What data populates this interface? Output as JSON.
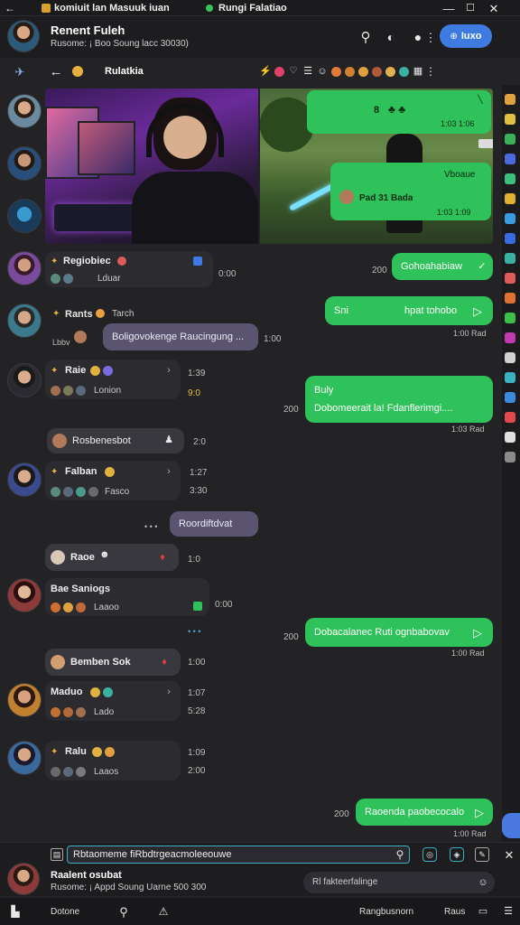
{
  "titlebar": {
    "title": "komiuit lan Masuuk iuan",
    "subtitle": "Rungi Falatiao"
  },
  "header": {
    "name": "Renent Fuleh",
    "status": "Rusome: ¡ Boo Soung lacc 30030)",
    "cta_label": "Iuxo"
  },
  "chatbar": {
    "title": "Rulatkia"
  },
  "sidebar_people": [
    {
      "name": "Regiobiec",
      "sub": "Lduar",
      "right": "0:00",
      "time": "",
      "tone": "#7a4a9c"
    },
    {
      "name": "Rants",
      "sub": "Tarch",
      "right": "",
      "time": "",
      "tone": "#3a7a8c"
    },
    {
      "name": "Raie",
      "sub": "Lonion",
      "right": "1:39",
      "time": "9:0",
      "tone": "#8c6a3a"
    },
    {
      "name": "Falban",
      "sub": "Fasco",
      "right": "1:27",
      "time": "3:30",
      "tone": "#3a4a8c"
    },
    {
      "name": "Bae Saniogs",
      "sub": "Laaoo",
      "right": "0:00",
      "time": "",
      "tone": "#8c3a3a"
    },
    {
      "name": "Maduo",
      "sub": "Lado",
      "right": "1:07",
      "time": "5:28",
      "tone": "#c08030"
    },
    {
      "name": "Ralu",
      "sub": "Laaos",
      "right": "1:09",
      "time": "2:00",
      "tone": "#3a6a9c"
    }
  ],
  "image_post": {
    "card1_text": "8",
    "card1_meta": "1:03 1:06",
    "card2_text": "Vboaue",
    "card2_line": "Pad 31 Bada",
    "card2_meta": "1:03 1:09"
  },
  "messages": {
    "m1": "Gohoahabiaw",
    "m1_time": "200",
    "m2_a": "Sni",
    "m2_b": "hpat tohobo",
    "m2_time": "1:00 Rad",
    "p1": "Boligovokenge Raucingung ...",
    "p1_time": "1:00",
    "p1_left": "Lbbv",
    "m3_a": "Buly",
    "m3_b": "Dobomeerait la! Fdanflerimgi....",
    "m3_time": "1:03 Rad",
    "m3_left": "200",
    "pill1": "Rosbenesbot",
    "pill1_time": "2:0",
    "p2": "Roordiftdvat",
    "pill2": "Raoe",
    "pill2_time": "1:0",
    "m4": "Dobacalanec Ruti ognbabovav",
    "m4_time": "1:00 Rad",
    "m4_left": "200",
    "pill3": "Bemben Sok",
    "pill3_time": "1:00",
    "m5": "Raoenda paobecocalo",
    "m5_time": "1:00 Rad",
    "m5_left": "200"
  },
  "composer": {
    "value": "Rbtaomeme fiRbdtrgeacmoleeouwe",
    "name": "Raalent osubat",
    "status": "Rusome: ¡ Appd Soung Uarne 500 300",
    "reply_placeholder": "Rl fakteerfalinge"
  },
  "bottom_nav": {
    "item1": "Dotone",
    "item2": "Rangbusnorn",
    "item3": "Raus"
  },
  "colors": {
    "accent_green": "#2fc25a",
    "accent_blue": "#3e7ae0",
    "bubble_purple": "#5a5470",
    "background": "#232326"
  },
  "icons": [
    "back-arrow-icon",
    "search-icon",
    "notification-icon",
    "dark-mode-icon",
    "more-icon",
    "send-icon",
    "attach-icon",
    "home-icon",
    "search-icon",
    "close-icon"
  ]
}
